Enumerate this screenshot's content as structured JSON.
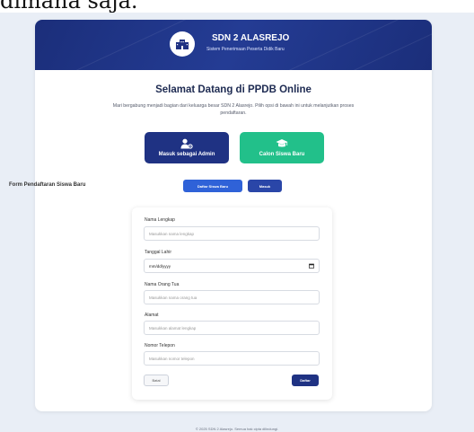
{
  "top_text": "dimana saja.",
  "header": {
    "school_name": "SDN 2 ALASREJO",
    "subtitle": "Sistem Penerimaan Peserta Didik Baru",
    "logo_icon": "school-building-icon"
  },
  "welcome": {
    "title": "Selamat Datang di PPDB Online",
    "description": "Mari bergabung menjadi bagian dari keluarga besar SDN 2 Alasrejo. Pilih opsi di bawah ini untuk melanjutkan proses pendaftaran."
  },
  "roles": {
    "admin": {
      "label": "Masuk sebagai Admin",
      "icon": "user-gear-icon",
      "color": "#1f3283"
    },
    "student": {
      "label": "Calon Siswa Baru",
      "icon": "graduation-cap-icon",
      "color": "#22c08a"
    }
  },
  "actions": {
    "register_label": "Daftar Siswa Baru",
    "login_label": "Masuk"
  },
  "form": {
    "title": "Form Pendaftaran Siswa Baru",
    "fields": {
      "name": {
        "label": "Nama Lengkap",
        "placeholder": "Masukkan nama lengkap"
      },
      "dob": {
        "label": "Tanggal Lahir",
        "value": "mm/dd/yyyy"
      },
      "parent": {
        "label": "Nama Orang Tua",
        "placeholder": "Masukkan nama orang tua"
      },
      "address": {
        "label": "Alamat",
        "placeholder": "Masukkan alamat lengkap"
      },
      "phone": {
        "label": "Nomor Telepon",
        "placeholder": "Masukkan nomor telepon"
      }
    },
    "cancel_label": "Batal",
    "submit_label": "Daftar"
  },
  "footer": "© 2025 SDN 2 Alasrejo. Semua hak cipta dilindungi."
}
